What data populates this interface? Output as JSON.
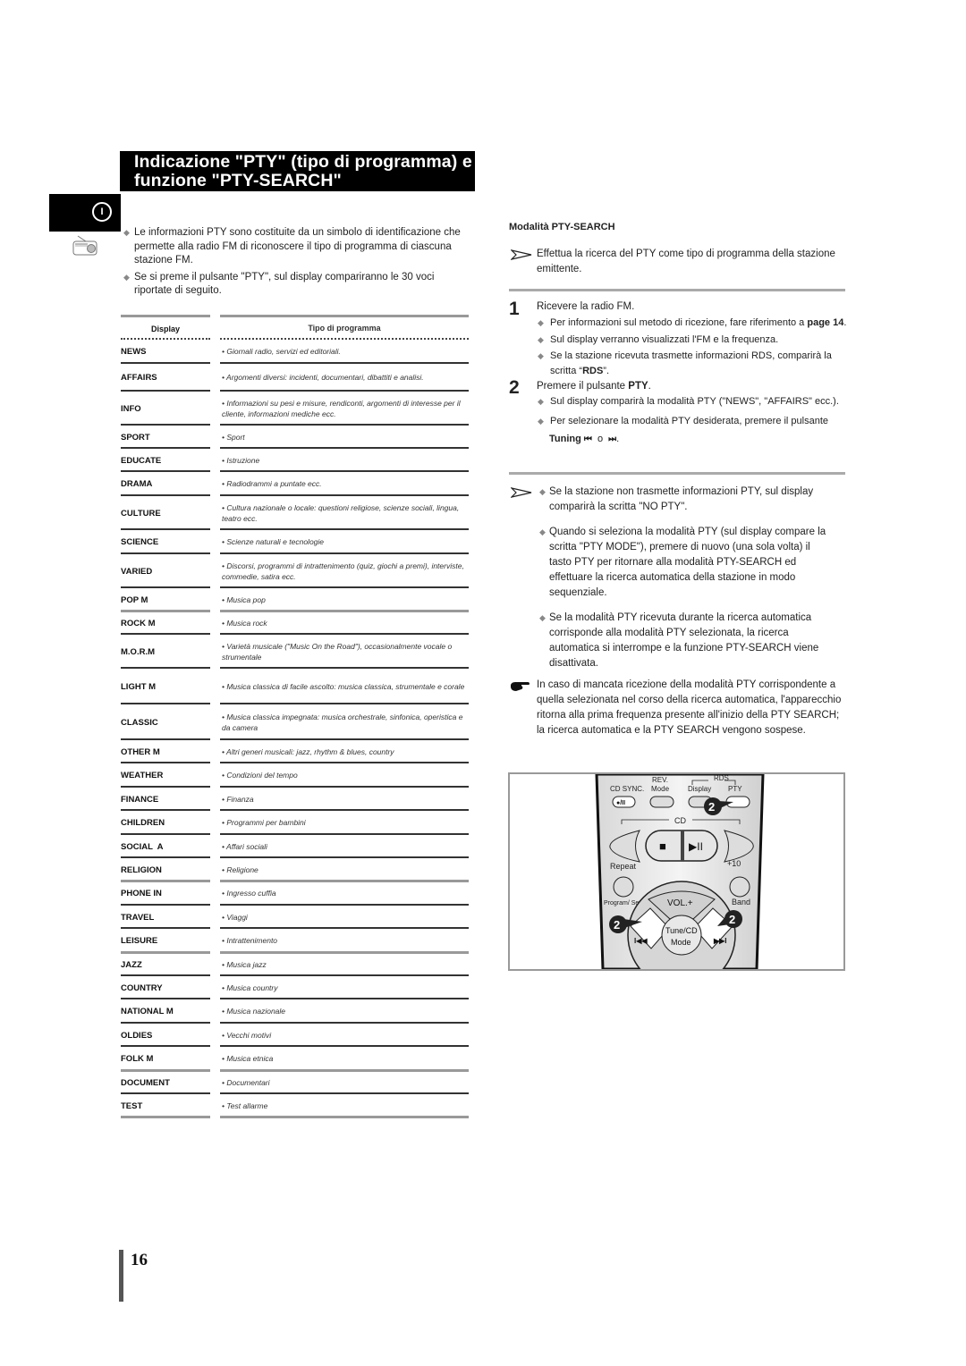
{
  "title": {
    "line1": "Indicazione \"PTY\" (tipo di programma) e",
    "line2": "funzione \"PTY-SEARCH\""
  },
  "language_tab": {
    "label": "I",
    "icon": "radio-icon"
  },
  "intro": [
    "Le informazioni PTY sono costituite da un simbolo di identificazione che permette alla radio FM di riconoscere il tipo di programma di ciascuna stazione FM.",
    "Se si preme il pulsante \"PTY\", sul display compariranno le 30 voci riportate di seguito."
  ],
  "table": {
    "headers": [
      "Display",
      "Tipo di programma"
    ],
    "rows": [
      {
        "display": "NEWS",
        "type": "• Giornali radio, servizi ed editoriali."
      },
      {
        "display": "AFFAIRS",
        "type": "• Argomenti diversi: incidenti, documentari, dibattiti e analisi."
      },
      {
        "display": "INFO",
        "type": "• Informazioni su pesi e misure, rendiconti, argomenti di interesse per il cliente, informazioni mediche ecc."
      },
      {
        "display": "SPORT",
        "type": "• Sport"
      },
      {
        "display": "EDUCATE",
        "type": "• Istruzione"
      },
      {
        "display": "DRAMA",
        "type": "• Radiodrammi a puntate ecc."
      },
      {
        "display": "CULTURE",
        "type": "• Cultura nazionale o locale: questioni religiose, scienze sociali, lingua, teatro ecc."
      },
      {
        "display": "SCIENCE",
        "type": "• Scienze naturali e tecnologie"
      },
      {
        "display": "VARIED",
        "type": "• Discorsi, programmi di intrattenimento (quiz, giochi a premi), interviste, commedie, satira ecc."
      },
      {
        "display": "POP M",
        "type": "• Musica pop"
      },
      {
        "display": "ROCK M",
        "type": "• Musica rock"
      },
      {
        "display": "M.O.R.M",
        "type": "• Varietà musicale (\"Music On the Road\"), occasionalmente vocale o strumentale"
      },
      {
        "display": "LIGHT M",
        "type": "• Musica classica di facile ascolto: musica classica, strumentale e corale"
      },
      {
        "display": "CLASSIC",
        "type": "• Musica classica impegnata: musica orchestrale, sinfonica, operistica e da camera"
      },
      {
        "display": "OTHER M",
        "type": "• Altri generi musicali: jazz, rhythm & blues, country"
      },
      {
        "display": "WEATHER",
        "type": "• Condizioni del tempo"
      },
      {
        "display": "FINANCE",
        "type": "• Finanza"
      },
      {
        "display": "CHILDREN",
        "type": "• Programmi per bambini"
      },
      {
        "display": "SOCIAL  A",
        "type": "• Affari sociali"
      },
      {
        "display": "RELIGION",
        "type": "• Religione"
      },
      {
        "display": "PHONE IN",
        "type": "• Ingresso cuffia"
      },
      {
        "display": "TRAVEL",
        "type": "• Viaggi"
      },
      {
        "display": "LEISURE",
        "type": "• Intrattenimento"
      },
      {
        "display": "JAZZ",
        "type": "• Musica jazz"
      },
      {
        "display": "COUNTRY",
        "type": "• Musica country"
      },
      {
        "display": "NATIONAL M",
        "type": "• Musica nazionale"
      },
      {
        "display": "OLDIES",
        "type": "• Vecchi motivi"
      },
      {
        "display": "FOLK M",
        "type": "• Musica etnica"
      },
      {
        "display": "DOCUMENT",
        "type": "• Documentari"
      },
      {
        "display": "TEST",
        "type": "• Test allarme"
      }
    ]
  },
  "pty_search": {
    "title": "Modalità PTY-SEARCH",
    "note": "Effettua la ricerca del PTY come tipo di programma della stazione emittente.",
    "steps": [
      {
        "num": "1",
        "title": "Ricevere la radio FM.",
        "bullets": [
          {
            "pre": "Per informazioni sul metodo di ricezione, fare riferimento a ",
            "bold": "page 14",
            "post": "."
          },
          {
            "pre": "Sul display verranno visualizzati l'FM e la frequenza.",
            "bold": "",
            "post": ""
          },
          {
            "pre": "Se la stazione ricevuta trasmette informazioni RDS, comparirà la scritta “",
            "bold": "RDS",
            "post": "”."
          }
        ]
      },
      {
        "num": "2",
        "title_pre": "Premere il pulsante ",
        "title_bold": "PTY",
        "title_post": ".",
        "bullets": [
          {
            "pre": "Sul display comparirà la modalità PTY (\"NEWS\", \"AFFAIRS\" ecc.).",
            "bold": "",
            "post": ""
          },
          {
            "pre": "Per selezionare la modalità PTY desiderata, premere il pulsante",
            "bold": "",
            "post": ""
          }
        ],
        "tuning_label": "Tuning",
        "tuning_prev": "⏮",
        "tuning_or": "o",
        "tuning_next": "⏭"
      }
    ],
    "notes": [
      "Se la stazione non trasmette informazioni PTY, sul display comparirà la scritta \"NO PTY\".",
      "Quando si seleziona la modalità PTY (sul display compare la scritta \"PTY MODE\"), premere di nuovo (una sola volta) il tasto PTY per ritornare alla modalità PTY-SEARCH ed effettuare la ricerca automatica della stazione in modo sequenziale.",
      "Se la modalità PTY ricevuta durante la ricerca automatica corrisponde alla modalità PTY selezionata, la ricerca automatica si interrompe e la funzione PTY-SEARCH viene disattivata."
    ],
    "hand_note": "In caso di mancata ricezione della modalità PTY corrispondente a quella selezionata nel corso della ricerca automatica, l'apparecchio ritorna alla prima frequenza presente all'inizio della PTY SEARCH; la ricerca automatica e la PTY SEARCH vengono sospese."
  },
  "remote": {
    "labels": {
      "cd_sync": "CD SYNC.",
      "rev": "REV.",
      "mode": "Mode",
      "rds": "RDS",
      "display": "Display",
      "pty": "PTY",
      "rec_pause": "●/II",
      "cd": "CD",
      "stop": "■",
      "play_pause": "▶II",
      "repeat": "Repeat",
      "plus10": "+10",
      "program_set": "Program/ Set",
      "band": "Band",
      "vol_plus": "VOL.+",
      "tune_cd": "Tune/CD",
      "tune_mode": "Mode",
      "prev": "I◀◀",
      "next": "▶▶I",
      "callout": "2"
    }
  },
  "page_number": "16"
}
